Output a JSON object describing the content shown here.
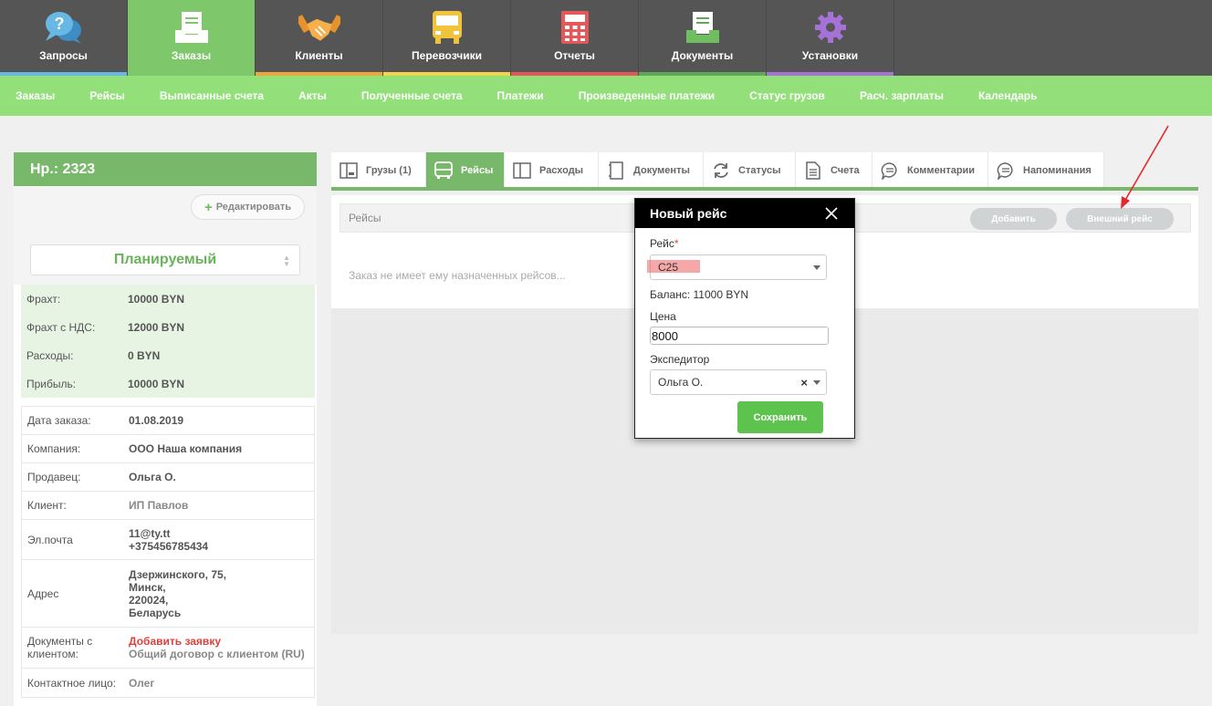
{
  "top_nav": {
    "tabs": [
      {
        "label": "Запросы",
        "icon": "help-chat-icon",
        "stripe": "#66b6ea"
      },
      {
        "label": "Заказы",
        "icon": "tray-icon",
        "stripe": "#7ec76b",
        "active": true
      },
      {
        "label": "Клиенты",
        "icon": "handshake-icon",
        "stripe": "#f0a53a"
      },
      {
        "label": "Перевозчики",
        "icon": "truck-icon",
        "stripe": "#f5d34a"
      },
      {
        "label": "Отчеты",
        "icon": "calculator-icon",
        "stripe": "#e4585a"
      },
      {
        "label": "Документы",
        "icon": "document-tray-icon",
        "stripe": "#5fa85a"
      },
      {
        "label": "Установки",
        "icon": "gear-icon",
        "stripe": "#a772d8"
      }
    ]
  },
  "sub_nav": {
    "items": [
      "Заказы",
      "Рейсы",
      "Выписанные счета",
      "Акты",
      "Полученные счета",
      "Платежи",
      "Произведенные платежи",
      "Статус грузов",
      "Расч. зарплаты",
      "Календарь"
    ]
  },
  "order": {
    "title": "Нр.: 2323",
    "edit_label": "Редактировать",
    "status": "Планируемый",
    "finance": [
      {
        "label": "Фрахт:",
        "value": "10000 BYN"
      },
      {
        "label": "Фрахт с НДС:",
        "value": "12000 BYN"
      },
      {
        "label": "Расходы:",
        "value": "0 BYN"
      },
      {
        "label": "Прибыль:",
        "value": "10000 BYN"
      }
    ],
    "info": {
      "date_label": "Дата заказа:",
      "date_value": "01.08.2019",
      "company_label": "Компания:",
      "company_value": "ООО Наша компания",
      "seller_label": "Продавец:",
      "seller_value": "Ольга О.",
      "client_label": "Клиент:",
      "client_value": "ИП Павлов",
      "email_label": "Эл.почта",
      "email_value": "11@ty.tt",
      "phone_value": "+375456785434",
      "address_label": "Адрес",
      "address_lines": [
        "Дзержинского, 75,",
        "Минск,",
        "220024,",
        "Беларусь"
      ],
      "docs_label_1": "Документы с",
      "docs_label_2": "клиентом:",
      "docs_add": "Добавить заявку",
      "docs_contract": "Общий договор с клиентом (RU)",
      "contact_label": "Контактное лицо:",
      "contact_value": "Олег"
    }
  },
  "detail_tabs": [
    {
      "label": "Грузы (1)",
      "icon": "cargo-icon"
    },
    {
      "label": "Рейсы",
      "icon": "bus-icon",
      "active": true
    },
    {
      "label": "Расходы",
      "icon": "expenses-icon"
    },
    {
      "label": "Документы",
      "icon": "documents-icon"
    },
    {
      "label": "Статусы",
      "icon": "refresh-icon"
    },
    {
      "label": "Счета",
      "icon": "invoice-icon"
    },
    {
      "label": "Комментарии",
      "icon": "comment-icon"
    },
    {
      "label": "Напоминания",
      "icon": "reminder-icon"
    }
  ],
  "trips": {
    "header": "Рейсы",
    "add_label": "Добавить",
    "external_label": "Внешний рейс",
    "empty_text": "Заказ не имеет ему назначенных рейсов..."
  },
  "modal": {
    "title": "Новый рейс",
    "trip_label": "Рейс",
    "required_mark": "*",
    "trip_value": "C25",
    "balance": "Баланс: 11000 BYN",
    "price_label": "Цена",
    "price_value": "8000",
    "forwarder_label": "Экспедитор",
    "forwarder_value": "Ольга О.",
    "clear_mark": "×",
    "save_label": "Сохранить"
  },
  "colors": {
    "accent_green": "#78b86b",
    "subnav_green": "#93e07b",
    "annotation_red": "#e8262a"
  }
}
